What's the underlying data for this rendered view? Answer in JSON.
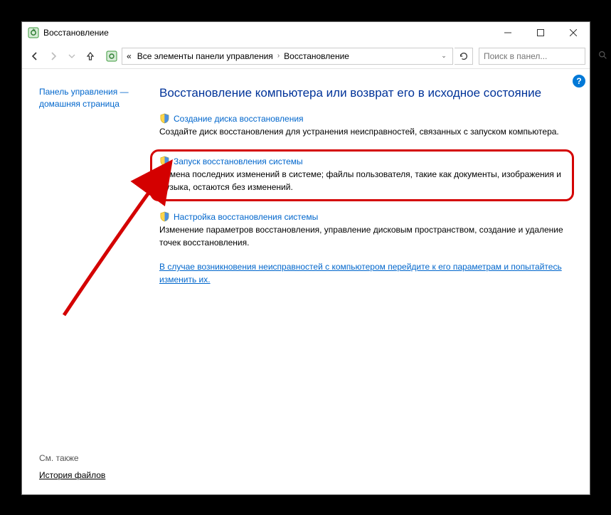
{
  "window": {
    "title": "Восстановление"
  },
  "nav": {
    "breadcrumb_prefix": "«",
    "breadcrumb_seg1": "Все элементы панели управления",
    "breadcrumb_seg2": "Восстановление",
    "search_placeholder": "Поиск в панел..."
  },
  "sidebar": {
    "home_line1": "Панель управления —",
    "home_line2": "домашняя страница",
    "see_also": "См. также",
    "file_history": "История файлов"
  },
  "content": {
    "heading": "Восстановление компьютера или возврат его в исходное состояние",
    "options": [
      {
        "title": "Создание диска восстановления",
        "desc": "Создайте диск восстановления для устранения неисправностей, связанных с запуском компьютера."
      },
      {
        "title": "Запуск восстановления системы",
        "desc": "Отмена последних изменений в системе; файлы пользователя, такие как документы, изображения и музыка, остаются без изменений."
      },
      {
        "title": "Настройка восстановления системы",
        "desc": "Изменение параметров восстановления, управление дисковым пространством, создание и удаление точек восстановления."
      }
    ],
    "extra_link": "В случае возникновения неисправностей с компьютером перейдите к его параметрам и попытайтесь изменить их."
  }
}
